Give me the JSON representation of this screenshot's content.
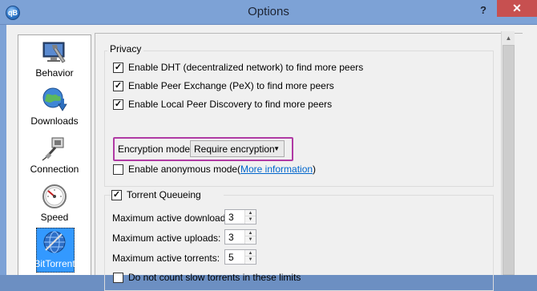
{
  "window": {
    "title": "Options",
    "help": "?",
    "close": "✕",
    "app_icon_text": "qB"
  },
  "sidebar": {
    "items": [
      {
        "label": "Behavior",
        "icon": "behavior-icon"
      },
      {
        "label": "Downloads",
        "icon": "downloads-globe-icon"
      },
      {
        "label": "Connection",
        "icon": "connection-plug-icon"
      },
      {
        "label": "Speed",
        "icon": "speed-gauge-icon"
      },
      {
        "label": "BitTorrent",
        "icon": "bittorrent-globe-icon",
        "selected": true
      }
    ]
  },
  "privacy": {
    "title": "Privacy",
    "dht": {
      "label": "Enable DHT (decentralized network) to find more peers",
      "checked": true
    },
    "pex": {
      "label": "Enable Peer Exchange (PeX) to find more peers",
      "checked": true
    },
    "lpd": {
      "label": "Enable Local Peer Discovery to find more peers",
      "checked": true
    },
    "encryption_label": "Encryption mode:",
    "encryption_value": "Require encryption",
    "anonymous": {
      "label": "Enable anonymous mode",
      "checked": false
    },
    "more_info_open": "(",
    "more_info_link": "More information",
    "more_info_close": ")"
  },
  "queueing": {
    "title": "Torrent Queueing",
    "checked": true,
    "max_downloads_label": "Maximum active downloads:",
    "max_downloads": "3",
    "max_uploads_label": "Maximum active uploads:",
    "max_uploads": "3",
    "max_torrents_label": "Maximum active torrents:",
    "max_torrents": "5",
    "slow_label": "Do not count slow torrents in these limits",
    "slow_checked": false
  },
  "colors": {
    "titlebar": "#7da2d6",
    "close": "#c75050",
    "selection": "#3399ff",
    "highlight": "#b03aa4",
    "link": "#0066cc"
  }
}
